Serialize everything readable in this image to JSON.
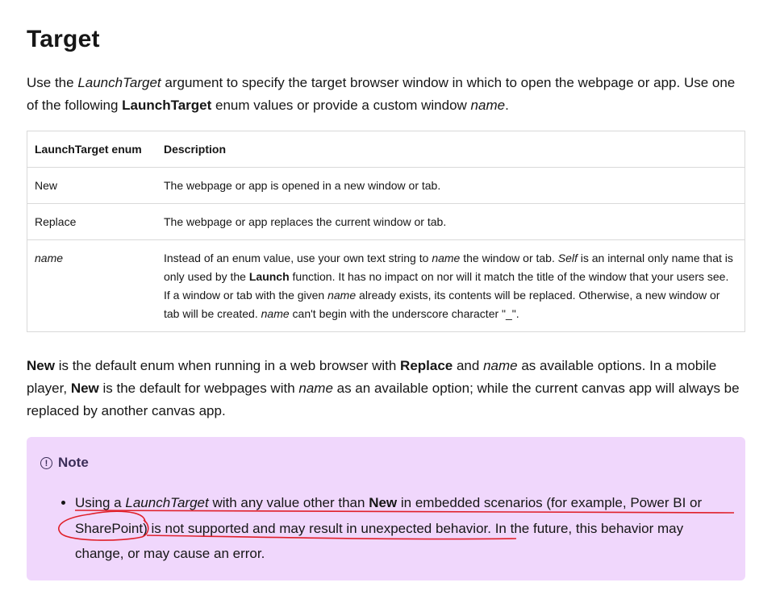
{
  "heading": "Target",
  "intro": {
    "p1": "Use the ",
    "em1": "LaunchTarget",
    "p2": " argument to specify the target browser window in which to open the webpage or app. Use one of the following ",
    "b1": "LaunchTarget",
    "p3": " enum values or provide a custom window ",
    "em2": "name",
    "p4": "."
  },
  "table": {
    "headers": [
      "LaunchTarget enum",
      "Description"
    ],
    "rows": [
      {
        "key": "New",
        "desc": "The webpage or app is opened in a new window or tab."
      },
      {
        "key": "Replace",
        "desc": "The webpage or app replaces the current window or tab."
      },
      {
        "key": "name",
        "d1": "Instead of an enum value, use your own text string to ",
        "d_em1": "name",
        "d2": " the window or tab. ",
        "d_em2": "Self",
        "d3": " is an internal only name that is only used by the ",
        "d_b1": "Launch",
        "d4": " function. It has no impact on nor will it match the title of the window that your users see. If a window or tab with the given ",
        "d_em3": "name",
        "d5": " already exists, its contents will be replaced. Otherwise, a new window or tab will be created. ",
        "d_em4": "name",
        "d6": " can't begin with the underscore character \"_\"."
      }
    ]
  },
  "outro": {
    "b1": "New",
    "t1": " is the default enum when running in a web browser with ",
    "b2": "Replace",
    "t2": " and ",
    "em1": "name",
    "t3": " as available options. In a mobile player, ",
    "b3": "New",
    "t4": " is the default for webpages with ",
    "em2": "name",
    "t5": " as an available option; while the current canvas app will always be replaced by another canvas app."
  },
  "note": {
    "icon": "info-icon",
    "title": "Note",
    "t1": "Using a ",
    "em1": "LaunchTarget",
    "t2": " with any value other than ",
    "b1": "New",
    "t3": " in embedded scenarios (for example, Power BI or SharePoint) is not supported and may result in unexpected behavior. In the future, this behavior may change, or may cause an error."
  },
  "colors": {
    "note_bg": "#f0d7fc",
    "annotation": "#e0202a"
  }
}
